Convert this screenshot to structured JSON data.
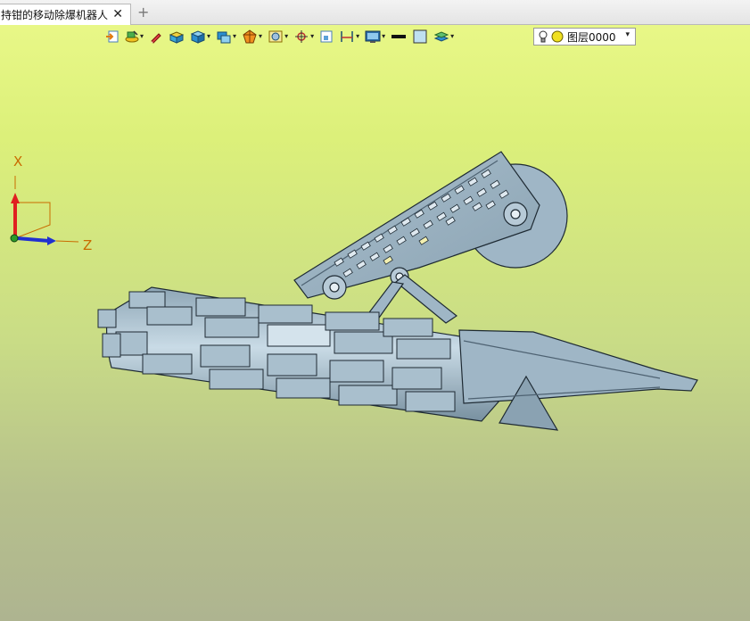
{
  "tabs": [
    {
      "label": "持钳的移动除爆机器人]",
      "active": true
    }
  ],
  "tab_close_glyph": "✕",
  "tab_add_glyph": "+",
  "toolbar": {
    "buttons": [
      {
        "icon": "exit-sketch-icon"
      },
      {
        "icon": "layers-edit-icon",
        "dropdown": true
      },
      {
        "icon": "pencil-icon"
      },
      {
        "icon": "paint-box-icon"
      },
      {
        "icon": "solid-box-icon",
        "dropdown": true
      },
      {
        "icon": "shaded-box-icon",
        "dropdown": true
      },
      {
        "icon": "render-style-icon",
        "dropdown": true
      },
      {
        "icon": "view-orient-icon",
        "dropdown": true
      },
      {
        "icon": "snap-icon",
        "dropdown": true
      },
      {
        "icon": "zoom-fit-icon"
      },
      {
        "icon": "dimension-icon",
        "dropdown": true
      },
      {
        "icon": "display-icon",
        "dropdown": true
      },
      {
        "icon": "line-style-icon"
      },
      {
        "icon": "fill-color-icon"
      },
      {
        "icon": "layer-stack-icon",
        "dropdown": true
      }
    ],
    "dropdown_glyph": "▾",
    "layer": {
      "name": "图层0000",
      "arrow": "▾"
    }
  },
  "axes": {
    "x_label": "X",
    "z_label": "Z"
  },
  "colors": {
    "model_fill": "#9fb6c6",
    "model_light": "#c6d8e4",
    "model_edge": "#1e2a33",
    "axis_x": "#e02020",
    "axis_z": "#2030d0",
    "axis_label": "#c96b00"
  }
}
